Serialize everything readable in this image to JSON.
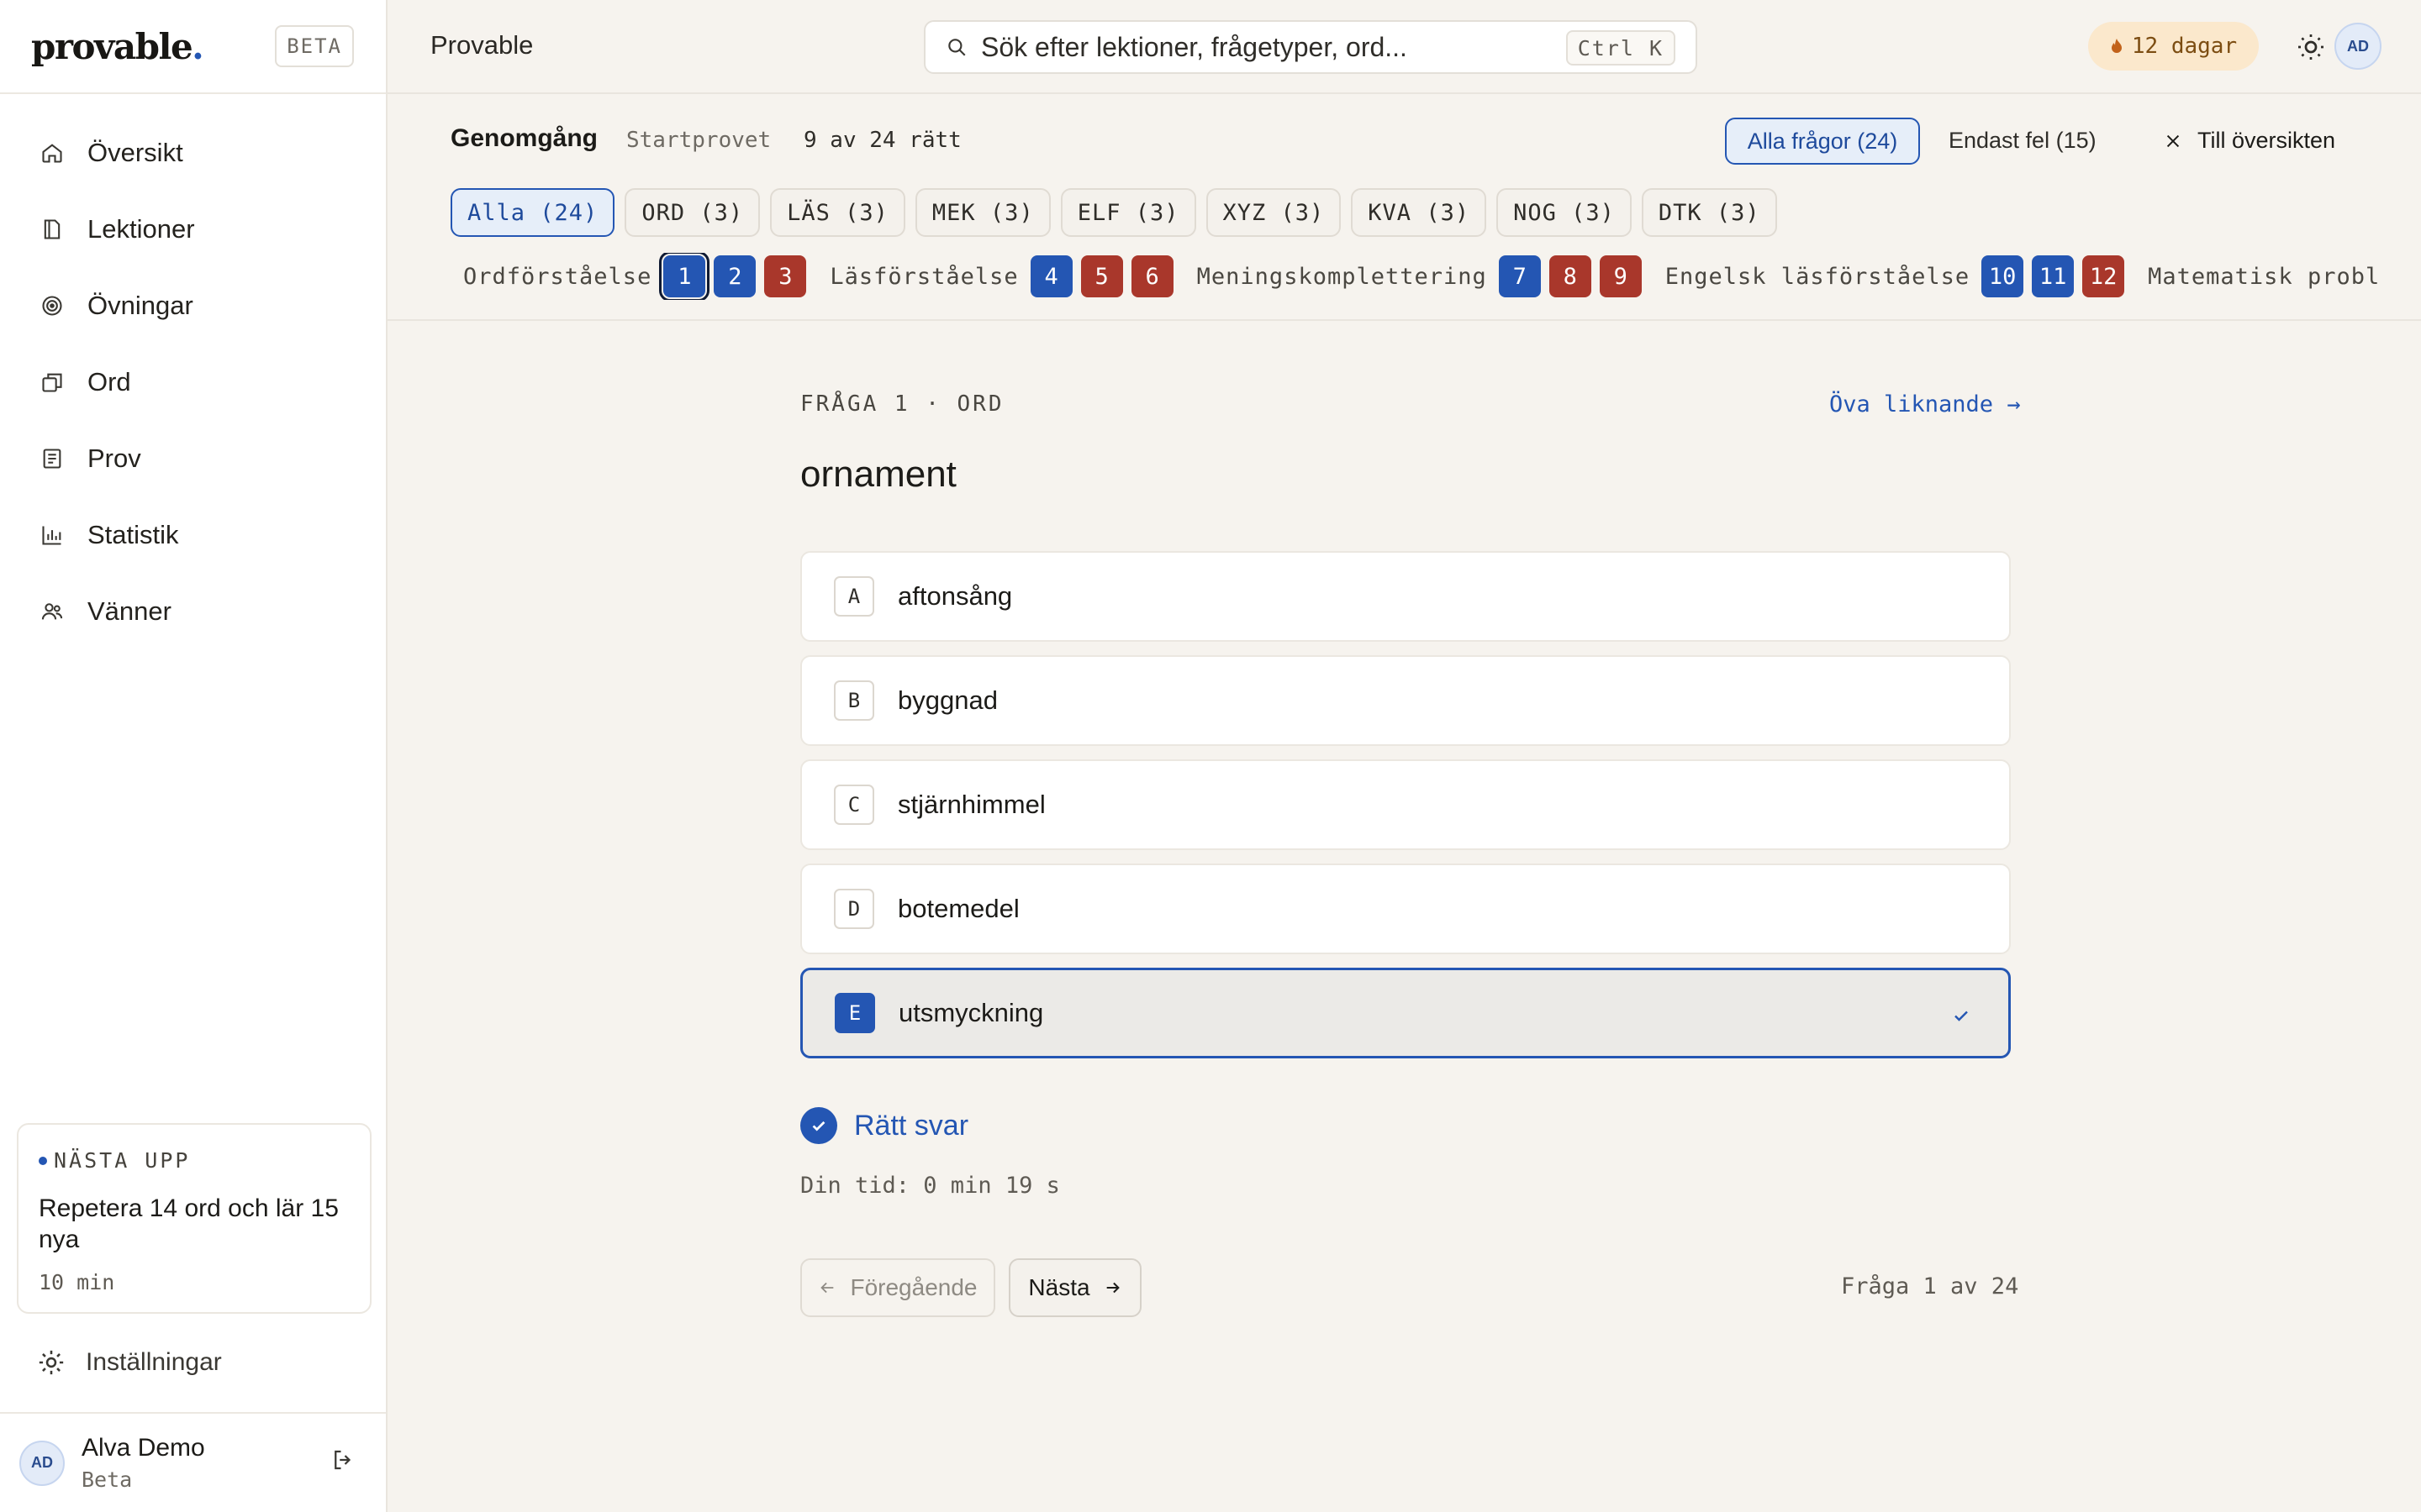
{
  "sidebar": {
    "logo": "provable",
    "logo_dot": ".",
    "beta_tag": "BETA",
    "items": [
      {
        "label": "Översikt",
        "icon": "home-icon"
      },
      {
        "label": "Lektioner",
        "icon": "book-icon"
      },
      {
        "label": "Övningar",
        "icon": "target-icon"
      },
      {
        "label": "Ord",
        "icon": "cards-icon"
      },
      {
        "label": "Prov",
        "icon": "document-icon"
      },
      {
        "label": "Statistik",
        "icon": "bar-chart-icon"
      },
      {
        "label": "Vänner",
        "icon": "users-icon"
      }
    ],
    "next_up": {
      "kicker": "NÄSTA UPP",
      "title": "Repetera 14 ord och lär 15 nya",
      "duration": "10 min"
    },
    "settings_label": "Inställningar",
    "user": {
      "initials": "AD",
      "name": "Alva Demo",
      "role": "Beta"
    }
  },
  "topbar": {
    "title": "Provable",
    "search_placeholder": "Sök efter lektioner, frågetyper, ord...",
    "shortcut": "Ctrl K",
    "streak": "12 dagar",
    "avatar_initials": "AD"
  },
  "review": {
    "title": "Genomgång",
    "test_name": "Startprovet",
    "score": "9 av 24 rätt",
    "filter_all": "Alla frågor (24)",
    "filter_wrong": "Endast fel (15)",
    "back_label": "Till översikten",
    "chips": [
      {
        "label": "Alla (24)",
        "active": true
      },
      {
        "label": "ORD (3)",
        "active": false
      },
      {
        "label": "LÄS (3)",
        "active": false
      },
      {
        "label": "MEK (3)",
        "active": false
      },
      {
        "label": "ELF (3)",
        "active": false
      },
      {
        "label": "XYZ (3)",
        "active": false
      },
      {
        "label": "KVA (3)",
        "active": false
      },
      {
        "label": "NOG (3)",
        "active": false
      },
      {
        "label": "DTK (3)",
        "active": false
      }
    ],
    "sections": [
      {
        "label": "Ordförståelse",
        "questions": [
          {
            "n": "1",
            "status": "right",
            "current": true
          },
          {
            "n": "2",
            "status": "right"
          },
          {
            "n": "3",
            "status": "wrong"
          }
        ]
      },
      {
        "label": "Läsförståelse",
        "questions": [
          {
            "n": "4",
            "status": "right"
          },
          {
            "n": "5",
            "status": "wrong"
          },
          {
            "n": "6",
            "status": "wrong"
          }
        ]
      },
      {
        "label": "Meningskomplettering",
        "questions": [
          {
            "n": "7",
            "status": "right"
          },
          {
            "n": "8",
            "status": "wrong"
          },
          {
            "n": "9",
            "status": "wrong"
          }
        ]
      },
      {
        "label": "Engelsk läsförståelse",
        "questions": [
          {
            "n": "10",
            "status": "right"
          },
          {
            "n": "11",
            "status": "right"
          },
          {
            "n": "12",
            "status": "wrong"
          }
        ]
      },
      {
        "label": "Matematisk problemlösning",
        "questions": []
      }
    ]
  },
  "question": {
    "meta": "FRÅGA 1 · ORD",
    "practice_link": "Öva liknande →",
    "word": "ornament",
    "options": [
      {
        "letter": "A",
        "text": "aftonsång",
        "selected": false
      },
      {
        "letter": "B",
        "text": "byggnad",
        "selected": false
      },
      {
        "letter": "C",
        "text": "stjärnhimmel",
        "selected": false
      },
      {
        "letter": "D",
        "text": "botemedel",
        "selected": false
      },
      {
        "letter": "E",
        "text": "utsmyckning",
        "selected": true
      }
    ],
    "result_label": "Rätt svar",
    "time_label": "Din tid: 0 min 19 s",
    "prev_label": "Föregående",
    "next_label": "Nästa",
    "counter": "Fråga 1 av 24"
  },
  "colors": {
    "accent": "#2456b3",
    "wrong": "#a9372b",
    "background": "#f6f3ee",
    "streak_bg": "#fbe8cc"
  }
}
